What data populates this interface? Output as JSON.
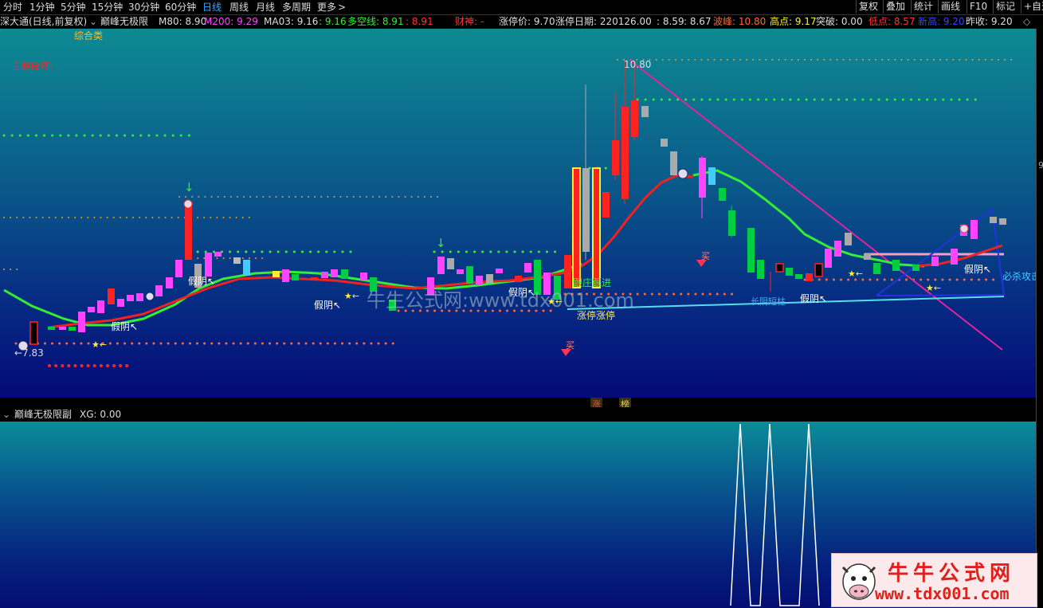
{
  "toolbar": {
    "timeframes": [
      "分时",
      "1分钟",
      "5分钟",
      "15分钟",
      "30分钟",
      "60分钟",
      "日线",
      "周线",
      "月线",
      "多周期",
      "更多"
    ],
    "more_arrow": ">",
    "buttons": [
      "复权",
      "叠加",
      "统计",
      "画线",
      "F10",
      "标记",
      "+自选"
    ]
  },
  "info": {
    "stock": "深大通(日线,前复权)",
    "indicator": "巅峰无极限",
    "m80": "M80: 8.90",
    "m200": "M200: 9.29",
    "ma03": "MA03: 9.16",
    "v916": ": 9.16",
    "duokong": "多空线: 8.91",
    "v891": ": 8.91",
    "caishen": "财神: -",
    "zhangtingjia": "涨停价: 9.70",
    "zhangtingriqi": "涨停日期: 220126.00",
    "v859": ": 8.59",
    "v867": ": 8.67",
    "bofeng": "波峰: 10.80",
    "gaodian": "高点: 9.17",
    "tupo": "突破: 0.00",
    "didian": "低点: 8.57",
    "xingao": "新高: 9.20",
    "zuoshou": "昨收: 9.20"
  },
  "chart": {
    "category_label": "综合类",
    "theme_label": "主题投资:",
    "label_high": "10.80",
    "label_low": "←7.83",
    "jiayin": [
      "假阴↖",
      "假阴↖",
      "假阴↖",
      "假阴↖",
      "假阴↖",
      "假阴↖"
    ],
    "star_marker": "★←",
    "buy_label": "买",
    "genzhuang": "跟庄跟进",
    "zhangting": "涨停涨停",
    "changyin": "长阴短柱",
    "bisha": "必杀攻击",
    "watermark": "牛生公式网:www.tdx001.com",
    "bottom_badges": [
      "涨",
      "榜"
    ],
    "right_edge_mark": "9"
  },
  "sub": {
    "indicator": "巅峰无极限副",
    "xg": "XG: 0.00"
  },
  "logo": {
    "title": "牛牛公式网",
    "url": "www.tdx001.com"
  },
  "colors": {
    "up": "#ff44ff",
    "down": "#00cc44",
    "fast_line": "#33ee33",
    "slow_line": "#ee2222",
    "trend_line": "#e0249a"
  }
}
